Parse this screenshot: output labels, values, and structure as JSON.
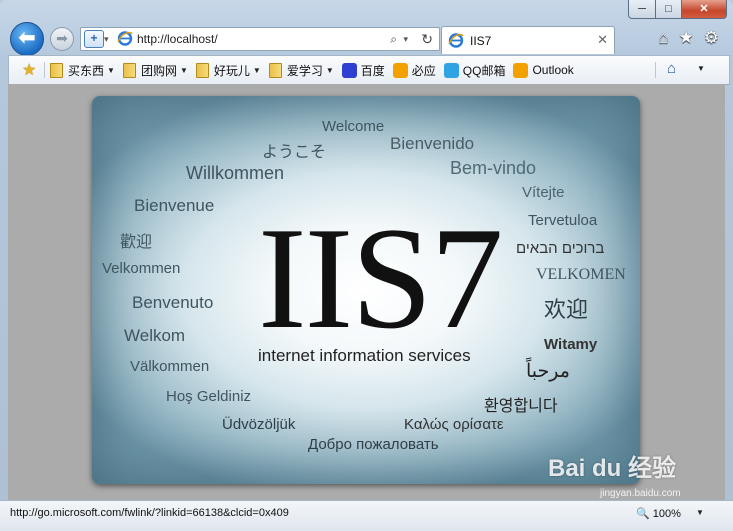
{
  "window": {
    "caption_min": "─",
    "caption_max": "□",
    "caption_close": "✕"
  },
  "nav": {
    "back_glyph": "⬅",
    "forward_glyph": "➡",
    "address_url": "http://localhost/",
    "search_glyph": "⌕",
    "refresh_glyph": "↻"
  },
  "tab": {
    "title": "IIS7",
    "close_glyph": "✕"
  },
  "toolbar_icons": [
    {
      "name": "home-icon",
      "glyph": "⌂"
    },
    {
      "name": "favorites-star-icon",
      "glyph": "★"
    },
    {
      "name": "tools-gear-icon",
      "glyph": "⚙"
    }
  ],
  "favorites": [
    {
      "label": "买东西",
      "type": "folder"
    },
    {
      "label": "团购网",
      "type": "folder"
    },
    {
      "label": "好玩儿",
      "type": "folder"
    },
    {
      "label": "爱学习",
      "type": "folder"
    },
    {
      "label": "百度",
      "type": "link",
      "icon": "baidu-paw-icon",
      "color": "#2f3fd1"
    },
    {
      "label": "必应",
      "type": "link",
      "icon": "bing-icon",
      "color": "#f2a100"
    },
    {
      "label": "QQ邮箱",
      "type": "link",
      "icon": "qq-mail-icon",
      "color": "#2fa3e4"
    },
    {
      "label": "Outlook",
      "type": "link",
      "icon": "outlook-icon",
      "color": "#f2a100"
    }
  ],
  "iis": {
    "logo": "IIS7",
    "subtitle": "internet information services",
    "welcome_words": [
      {
        "text": "Welcome",
        "size": 15
      },
      {
        "text": "ようこそ",
        "size": 16
      },
      {
        "text": "Bienvenido",
        "size": 17
      },
      {
        "text": "Willkommen",
        "size": 18
      },
      {
        "text": "Bem-vindo",
        "size": 18
      },
      {
        "text": "Vítejte",
        "size": 15
      },
      {
        "text": "Bienvenue",
        "size": 17
      },
      {
        "text": "Tervetuloa",
        "size": 15
      },
      {
        "text": "歡迎",
        "size": 16
      },
      {
        "text": "ברוכים הבאים",
        "size": 15
      },
      {
        "text": "Velkommen",
        "size": 15
      },
      {
        "text": "VELKOMEN",
        "size": 16
      },
      {
        "text": "Benvenuto",
        "size": 17
      },
      {
        "text": "欢迎",
        "size": 22
      },
      {
        "text": "Welkom",
        "size": 17
      },
      {
        "text": "Witamy",
        "size": 15
      },
      {
        "text": "Välkommen",
        "size": 15
      },
      {
        "text": "مرحباً",
        "size": 19
      },
      {
        "text": "Hoş Geldiniz",
        "size": 15
      },
      {
        "text": "환영합니다",
        "size": 16
      },
      {
        "text": "Üdvözöljük",
        "size": 15
      },
      {
        "text": "Καλώς ορίσατε",
        "size": 15
      },
      {
        "text": "Добро пожаловать",
        "size": 15
      }
    ]
  },
  "status": {
    "url": "http://go.microsoft.com/fwlink/?linkid=66138&clcid=0x409",
    "zoom": "100%"
  },
  "watermark": {
    "text": "Bai du 经验",
    "sub": "jingyan.baidu.com"
  }
}
